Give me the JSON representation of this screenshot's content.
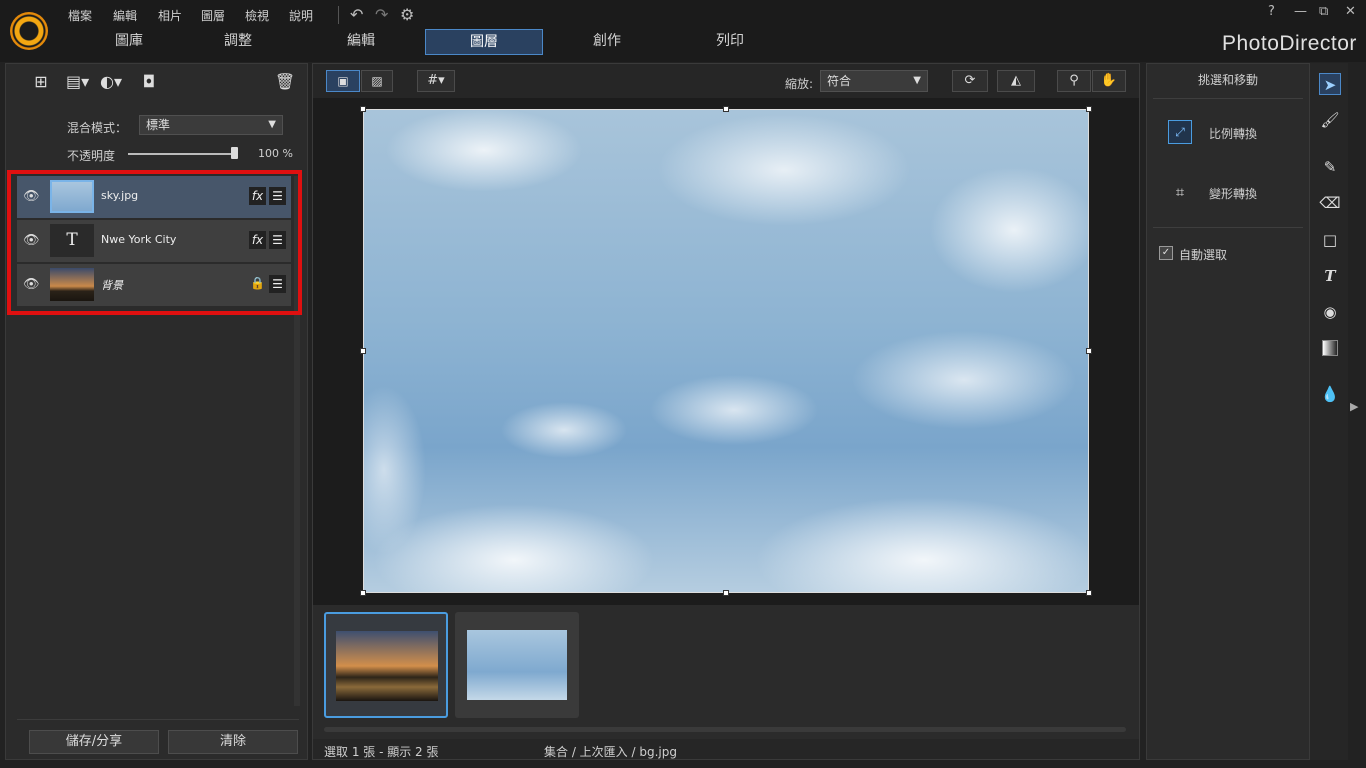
{
  "app": {
    "brand": "PhotoDirector"
  },
  "menu": [
    "檔案",
    "編輯",
    "相片",
    "圖層",
    "檢視",
    "說明"
  ],
  "window_controls": {
    "help": "?",
    "minimize": "—",
    "restore": "⧉",
    "close": "✕"
  },
  "tabs": [
    {
      "label": "圖庫",
      "active": false
    },
    {
      "label": "調整",
      "active": false
    },
    {
      "label": "編輯",
      "active": false
    },
    {
      "label": "圖層",
      "active": true
    },
    {
      "label": "創作",
      "active": false
    },
    {
      "label": "列印",
      "active": false
    }
  ],
  "left": {
    "blend_label": "混合模式：",
    "blend_value": "標準",
    "opacity_label": "不透明度",
    "opacity_value": "100 %",
    "opacity_level": 1.0,
    "layers": [
      {
        "name": "sky.jpg",
        "has_fx": true,
        "locked": false,
        "selected": true
      },
      {
        "name": "Nwe York City",
        "has_fx": true,
        "locked": false,
        "selected": false
      },
      {
        "name": "背景",
        "has_fx": false,
        "locked": true,
        "selected": false
      }
    ],
    "text_layer_glyph": "T",
    "save_button": "儲存/分享",
    "clear_button": "清除"
  },
  "center": {
    "zoom_label": "縮放:",
    "zoom_value": "符合",
    "status_left": "選取 1 張 - 顯示 2 張",
    "status_path": "集合 / 上次匯入 / bg.jpg"
  },
  "right": {
    "title": "挑選和移動",
    "items": [
      "比例轉換",
      "變形轉換"
    ],
    "auto_select": "自動選取",
    "auto_select_checked": true
  },
  "colors": {
    "accent": "#4a9ce0",
    "highlight": "#e01010",
    "selected_layer": "#47566a"
  }
}
